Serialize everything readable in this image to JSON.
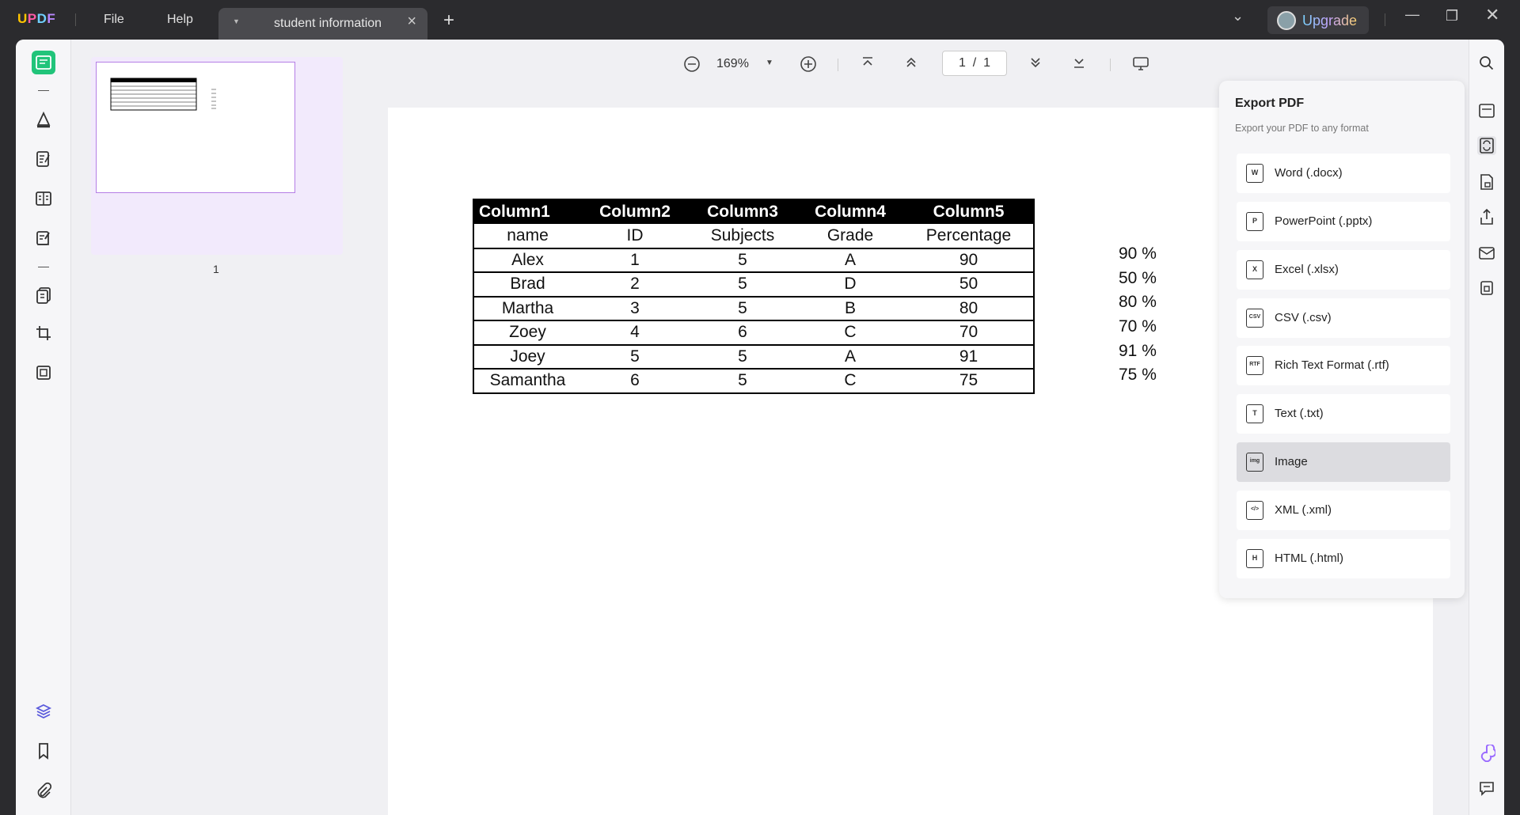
{
  "app": {
    "logo": {
      "u": "U",
      "p": "P",
      "d": "D",
      "f": "F"
    },
    "menu": {
      "file": "File",
      "help": "Help"
    },
    "tab": {
      "title": "student information"
    },
    "upgrade_label": "Upgrade"
  },
  "thumbnails": {
    "page_label": "1"
  },
  "viewer": {
    "zoom": "169%",
    "page_current": "1",
    "page_sep": "/",
    "page_total": "1"
  },
  "document": {
    "headers": [
      "Column1",
      "Column2",
      "Column3",
      "Column4",
      "Column5"
    ],
    "subheaders": [
      "name",
      "ID",
      "Subjects",
      "Grade",
      "Percentage"
    ],
    "rows": [
      [
        "Alex",
        "1",
        "5",
        "A",
        "90"
      ],
      [
        "Brad",
        "2",
        "5",
        "D",
        "50"
      ],
      [
        "Martha",
        "3",
        "5",
        "B",
        "80"
      ],
      [
        "Zoey",
        "4",
        "6",
        "C",
        "70"
      ],
      [
        "Joey",
        "5",
        "5",
        "A",
        "91"
      ],
      [
        "Samantha",
        "6",
        "5",
        "C",
        "75"
      ]
    ],
    "percent_column": [
      "90 %",
      "50 %",
      "80 %",
      "70 %",
      "91 %",
      "75 %"
    ]
  },
  "export_panel": {
    "title": "Export PDF",
    "subtitle": "Export your PDF to any format",
    "items": [
      {
        "label": "Word (.docx)",
        "icon": "W"
      },
      {
        "label": "PowerPoint (.pptx)",
        "icon": "P"
      },
      {
        "label": "Excel (.xlsx)",
        "icon": "X"
      },
      {
        "label": "CSV (.csv)",
        "icon": "CSV"
      },
      {
        "label": "Rich Text Format (.rtf)",
        "icon": "RTF"
      },
      {
        "label": "Text (.txt)",
        "icon": "T"
      },
      {
        "label": "Image",
        "icon": "img"
      },
      {
        "label": "XML (.xml)",
        "icon": "</>"
      },
      {
        "label": "HTML (.html)",
        "icon": "H"
      }
    ],
    "selected": "Image"
  },
  "colors": {
    "accent_green": "#21c47a",
    "thumb_border": "#b57ee6",
    "titlebar": "#2b2b2e"
  }
}
